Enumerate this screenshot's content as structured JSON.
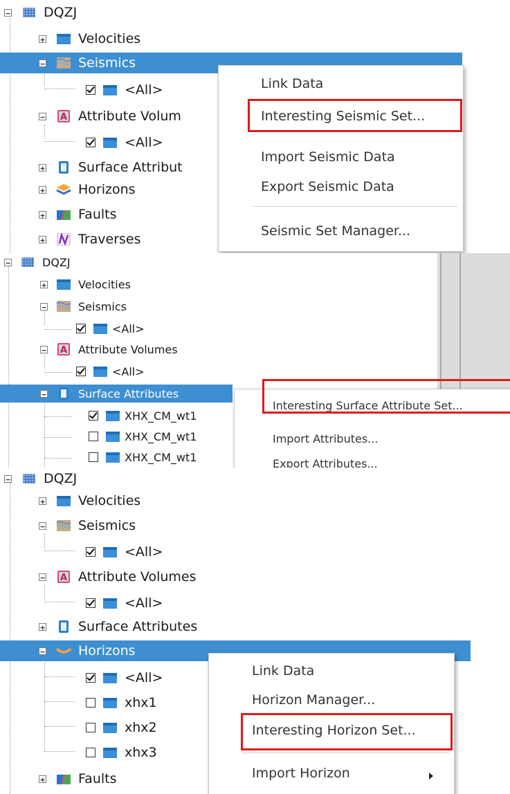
{
  "panel1": {
    "root_label": "DQZJ",
    "items": [
      "Velocities",
      "Seismics",
      "<All>",
      "Attribute Volum",
      "<All>",
      "Surface Attribut",
      "Horizons",
      "Faults",
      "Traverses"
    ],
    "menu": [
      "Link Data",
      "Interesting Seismic Set...",
      "Import Seismic Data",
      "Export Seismic Data",
      "Seismic Set Manager..."
    ],
    "highlighted_item": "Interesting Seismic Set..."
  },
  "panel2": {
    "root_label": "DQZJ",
    "items": [
      "Velocities",
      "Seismics",
      "<All>",
      "Attribute Volumes",
      "<All>",
      "Surface Attributes",
      "XHX_CM_wt1",
      "XHX_CM_wt1",
      "XHX_CM_wt1"
    ],
    "menu": [
      "Interesting Surface Attribute Set...",
      "Import Attributes...",
      "Export Attributes..."
    ],
    "highlighted_item": "Interesting Surface Attribute Set..."
  },
  "panel3": {
    "root_label": "DQZJ",
    "items": [
      "Velocities",
      "Seismics",
      "<All>",
      "Attribute Volumes",
      "<All>",
      "Surface Attributes",
      "Horizons",
      "<All>",
      "xhx1",
      "xhx2",
      "xhx3",
      "Faults"
    ],
    "menu": [
      "Link Data",
      "Horizon Manager...",
      "Interesting Horizon Set...",
      "Import Horizon"
    ],
    "highlighted_item": "Interesting Horizon Set..."
  },
  "colors": {
    "selection": "#3d8fd1",
    "highlight_box": "#e01a1a"
  },
  "icons": [
    "project-grid-icon",
    "folder-icon",
    "seismic-icon",
    "attribute-volume-icon",
    "surface-attribute-icon",
    "horizon-icon",
    "faults-icon",
    "traverse-icon",
    "checkbox-icon",
    "submenu-arrow-icon"
  ]
}
